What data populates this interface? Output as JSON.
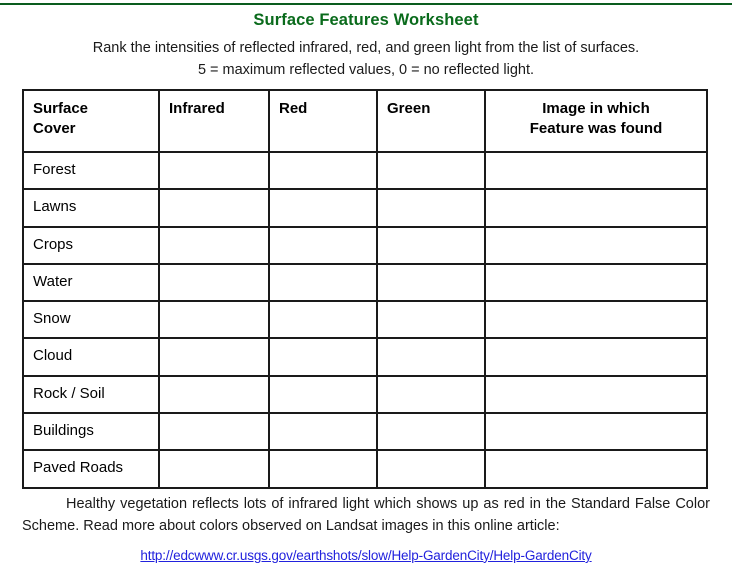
{
  "document": {
    "title": "Surface Features Worksheet",
    "subtitle_line1": "Rank the intensities of reflected infrared, red, and green light from the list of surfaces.",
    "subtitle_line2": "5 = maximum reflected values, 0 = no reflected light.",
    "title_color": "#0a6b1c",
    "link_color": "#2222dd",
    "rule_color": "#0a5c1e"
  },
  "table": {
    "headers": {
      "surface_cover_line1": "Surface",
      "surface_cover_line2": "Cover",
      "infrared": "Infrared",
      "red": "Red",
      "green": "Green",
      "image_line1": "Image in which",
      "image_line2": "Feature was found"
    },
    "rows": [
      {
        "surface_cover": "Forest",
        "infrared": "",
        "red": "",
        "green": "",
        "image": ""
      },
      {
        "surface_cover": "Lawns",
        "infrared": "",
        "red": "",
        "green": "",
        "image": ""
      },
      {
        "surface_cover": "Crops",
        "infrared": "",
        "red": "",
        "green": "",
        "image": ""
      },
      {
        "surface_cover": "Water",
        "infrared": "",
        "red": "",
        "green": "",
        "image": ""
      },
      {
        "surface_cover": "Snow",
        "infrared": "",
        "red": "",
        "green": "",
        "image": ""
      },
      {
        "surface_cover": "Cloud",
        "infrared": "",
        "red": "",
        "green": "",
        "image": ""
      },
      {
        "surface_cover": "Rock / Soil",
        "infrared": "",
        "red": "",
        "green": "",
        "image": ""
      },
      {
        "surface_cover": "Buildings",
        "infrared": "",
        "red": "",
        "green": "",
        "image": ""
      },
      {
        "surface_cover": "Paved Roads",
        "infrared": "",
        "red": "",
        "green": "",
        "image": ""
      }
    ]
  },
  "footer": {
    "paragraph": "Healthy vegetation reflects lots of infrared light which shows up as red in the Standard False Color Scheme. Read more about colors observed on Landsat images in this online article:",
    "link_text": "http://edcwww.cr.usgs.gov/earthshots/slow/Help-GardenCity/Help-GardenCity"
  }
}
